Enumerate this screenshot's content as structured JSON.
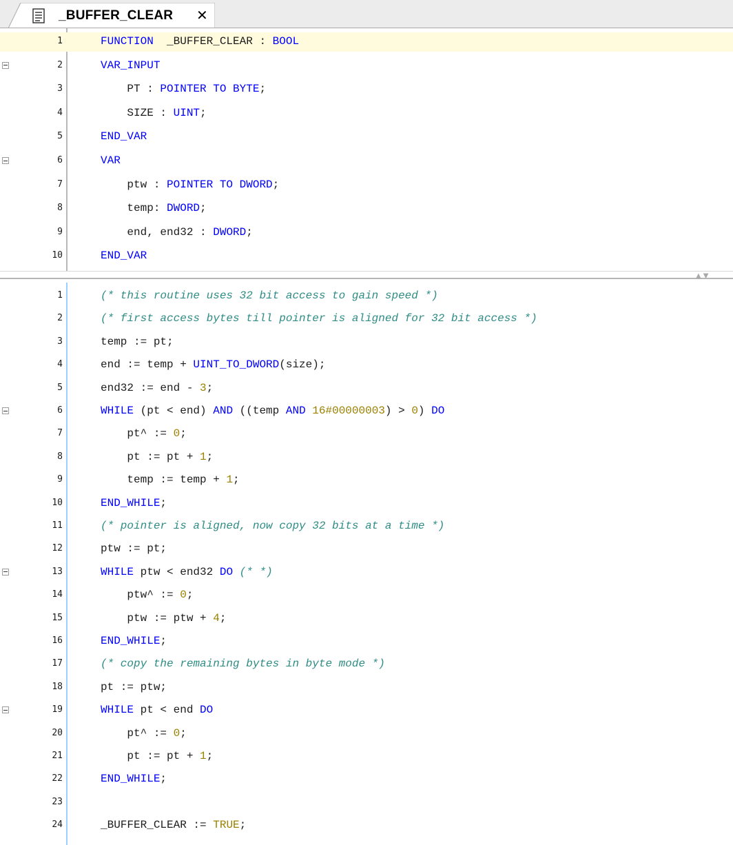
{
  "tab": {
    "title": "_BUFFER_CLEAR",
    "close_glyph": "✕",
    "icon": "document-icon"
  },
  "colors": {
    "keyword": "#0000ff",
    "number": "#9a8000",
    "comment": "#2e8c85",
    "highlight_line": "#fffbdc",
    "change_bar": "#9ad0ff"
  },
  "declaration": {
    "lines": [
      {
        "n": "1",
        "fold": false,
        "highlight": true,
        "tokens": [
          [
            "kw",
            "FUNCTION"
          ],
          [
            "",
            "  _BUFFER_CLEAR : "
          ],
          [
            "kw",
            "BOOL"
          ]
        ]
      },
      {
        "n": "2",
        "fold": true,
        "tokens": [
          [
            "kw",
            "VAR_INPUT"
          ]
        ]
      },
      {
        "n": "3",
        "fold": false,
        "tokens": [
          [
            "",
            "    PT : "
          ],
          [
            "kw",
            "POINTER TO BYTE"
          ],
          [
            "",
            ";"
          ]
        ]
      },
      {
        "n": "4",
        "fold": false,
        "tokens": [
          [
            "",
            "    SIZE : "
          ],
          [
            "kw",
            "UINT"
          ],
          [
            "",
            ";"
          ]
        ]
      },
      {
        "n": "5",
        "fold": false,
        "tokens": [
          [
            "kw",
            "END_VAR"
          ]
        ]
      },
      {
        "n": "6",
        "fold": true,
        "tokens": [
          [
            "kw",
            "VAR"
          ]
        ]
      },
      {
        "n": "7",
        "fold": false,
        "tokens": [
          [
            "",
            "    ptw : "
          ],
          [
            "kw",
            "POINTER TO DWORD"
          ],
          [
            "",
            ";"
          ]
        ]
      },
      {
        "n": "8",
        "fold": false,
        "tokens": [
          [
            "",
            "    temp: "
          ],
          [
            "kw",
            "DWORD"
          ],
          [
            "",
            ";"
          ]
        ]
      },
      {
        "n": "9",
        "fold": false,
        "tokens": [
          [
            "",
            "    end, end32 : "
          ],
          [
            "kw",
            "DWORD"
          ],
          [
            "",
            ";"
          ]
        ]
      },
      {
        "n": "10",
        "fold": false,
        "tokens": [
          [
            "kw",
            "END_VAR"
          ]
        ]
      }
    ]
  },
  "implementation": {
    "lines": [
      {
        "n": "1",
        "fold": false,
        "tokens": [
          [
            "cmt",
            "(* this routine uses 32 bit access to gain speed *)"
          ]
        ]
      },
      {
        "n": "2",
        "fold": false,
        "tokens": [
          [
            "cmt",
            "(* first access bytes till pointer is aligned for 32 bit access *)"
          ]
        ]
      },
      {
        "n": "3",
        "fold": false,
        "tokens": [
          [
            "",
            "temp := pt;"
          ]
        ]
      },
      {
        "n": "4",
        "fold": false,
        "tokens": [
          [
            "",
            "end := temp + "
          ],
          [
            "kw",
            "UINT_TO_DWORD"
          ],
          [
            "",
            "(size);"
          ]
        ]
      },
      {
        "n": "5",
        "fold": false,
        "tokens": [
          [
            "",
            "end32 := end - "
          ],
          [
            "num",
            "3"
          ],
          [
            "",
            ";"
          ]
        ]
      },
      {
        "n": "6",
        "fold": true,
        "tokens": [
          [
            "kw",
            "WHILE"
          ],
          [
            "",
            " (pt < end) "
          ],
          [
            "kw",
            "AND"
          ],
          [
            "",
            " ((temp "
          ],
          [
            "kw",
            "AND"
          ],
          [
            "",
            " "
          ],
          [
            "num",
            "16#00000003"
          ],
          [
            "",
            ") > "
          ],
          [
            "num",
            "0"
          ],
          [
            "",
            ") "
          ],
          [
            "kw",
            "DO"
          ]
        ]
      },
      {
        "n": "7",
        "fold": false,
        "tokens": [
          [
            "",
            "    pt^ := "
          ],
          [
            "num",
            "0"
          ],
          [
            "",
            ";"
          ]
        ]
      },
      {
        "n": "8",
        "fold": false,
        "tokens": [
          [
            "",
            "    pt := pt + "
          ],
          [
            "num",
            "1"
          ],
          [
            "",
            ";"
          ]
        ]
      },
      {
        "n": "9",
        "fold": false,
        "tokens": [
          [
            "",
            "    temp := temp + "
          ],
          [
            "num",
            "1"
          ],
          [
            "",
            ";"
          ]
        ]
      },
      {
        "n": "10",
        "fold": false,
        "tokens": [
          [
            "kw",
            "END_WHILE"
          ],
          [
            "",
            ";"
          ]
        ]
      },
      {
        "n": "11",
        "fold": false,
        "tokens": [
          [
            "cmt",
            "(* pointer is aligned, now copy 32 bits at a time *)"
          ]
        ]
      },
      {
        "n": "12",
        "fold": false,
        "tokens": [
          [
            "",
            "ptw := pt;"
          ]
        ]
      },
      {
        "n": "13",
        "fold": true,
        "tokens": [
          [
            "kw",
            "WHILE"
          ],
          [
            "",
            " ptw < end32 "
          ],
          [
            "kw",
            "DO"
          ],
          [
            "",
            " "
          ],
          [
            "cmt",
            "(* *)"
          ]
        ]
      },
      {
        "n": "14",
        "fold": false,
        "tokens": [
          [
            "",
            "    ptw^ := "
          ],
          [
            "num",
            "0"
          ],
          [
            "",
            ";"
          ]
        ]
      },
      {
        "n": "15",
        "fold": false,
        "tokens": [
          [
            "",
            "    ptw := ptw + "
          ],
          [
            "num",
            "4"
          ],
          [
            "",
            ";"
          ]
        ]
      },
      {
        "n": "16",
        "fold": false,
        "tokens": [
          [
            "kw",
            "END_WHILE"
          ],
          [
            "",
            ";"
          ]
        ]
      },
      {
        "n": "17",
        "fold": false,
        "tokens": [
          [
            "cmt",
            "(* copy the remaining bytes in byte mode *)"
          ]
        ]
      },
      {
        "n": "18",
        "fold": false,
        "tokens": [
          [
            "",
            "pt := ptw;"
          ]
        ]
      },
      {
        "n": "19",
        "fold": true,
        "tokens": [
          [
            "kw",
            "WHILE"
          ],
          [
            "",
            " pt < end "
          ],
          [
            "kw",
            "DO"
          ]
        ]
      },
      {
        "n": "20",
        "fold": false,
        "tokens": [
          [
            "",
            "    pt^ := "
          ],
          [
            "num",
            "0"
          ],
          [
            "",
            ";"
          ]
        ]
      },
      {
        "n": "21",
        "fold": false,
        "tokens": [
          [
            "",
            "    pt := pt + "
          ],
          [
            "num",
            "1"
          ],
          [
            "",
            ";"
          ]
        ]
      },
      {
        "n": "22",
        "fold": false,
        "tokens": [
          [
            "kw",
            "END_WHILE"
          ],
          [
            "",
            ";"
          ]
        ]
      },
      {
        "n": "23",
        "fold": false,
        "tokens": []
      },
      {
        "n": "24",
        "fold": false,
        "tokens": [
          [
            "",
            "_BUFFER_CLEAR := "
          ],
          [
            "num",
            "TRUE"
          ],
          [
            "",
            ";"
          ]
        ]
      }
    ]
  }
}
